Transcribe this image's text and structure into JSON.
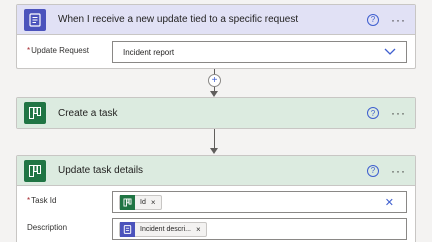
{
  "trigger": {
    "title": "When I receive a new update tied to a specific request",
    "help": "?",
    "more": "···",
    "fields": [
      {
        "label": "Update Request",
        "required": "*",
        "value": "Incident report"
      }
    ]
  },
  "connector1": {
    "add_symbol": "+"
  },
  "create_task": {
    "title": "Create a task",
    "help": "?",
    "more": "···"
  },
  "update_task": {
    "title": "Update task details",
    "help": "?",
    "more": "···",
    "task_id": {
      "label": "Task Id",
      "required": "*",
      "token": "Id",
      "token_remove": "×",
      "clear": "✕"
    },
    "description": {
      "label": "Description",
      "token": "Incident descri...",
      "token_remove": "×"
    }
  },
  "colors": {
    "trigger_header": "#e1e1f5",
    "trigger_icon": "#4b53bc",
    "action_header": "#dcebe0",
    "action_icon": "#207544",
    "link_blue": "#3f5fcf"
  },
  "icons": {
    "trigger": "forms-icon",
    "action": "planner-icon"
  }
}
